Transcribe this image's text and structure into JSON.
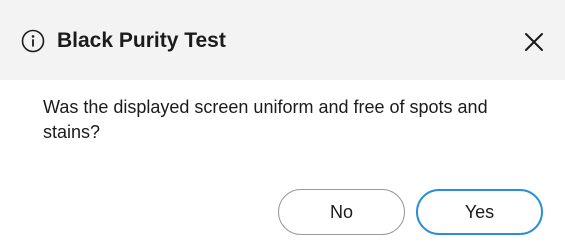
{
  "dialog": {
    "title": "Black Purity Test",
    "title_icon": "info-icon",
    "close_icon": "close-icon",
    "message": "Was the displayed screen uniform and free of spots and stains?",
    "buttons": {
      "no_label": "No",
      "yes_label": "Yes"
    }
  },
  "colors": {
    "header_background": "#f3f3f3",
    "primary_button_border": "#2b8fd6",
    "secondary_button_border": "#9a9a9a",
    "text": "#1b1b1b"
  }
}
